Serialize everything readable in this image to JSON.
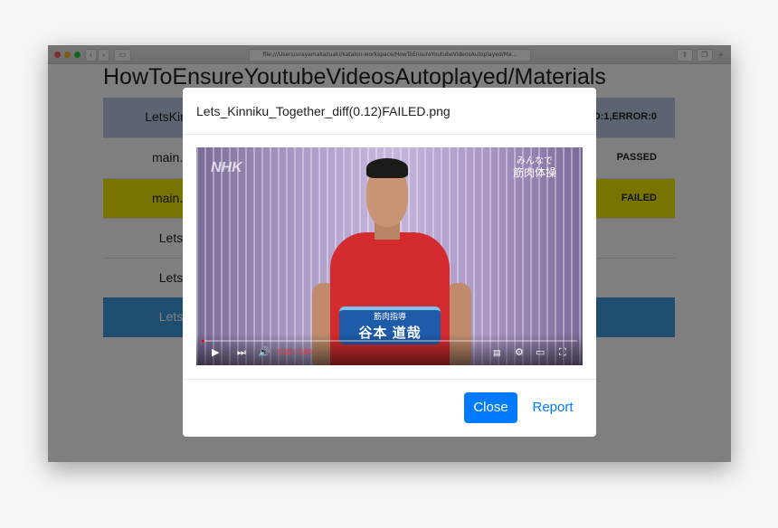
{
  "browser": {
    "url": "file:///Users/urayamakazuaki/katalon-workspace/HowToEnsureYoutubeVideosAutoplayed/Ma..."
  },
  "page": {
    "title": "HowToEnsureYoutubeVideosAutoplayed/Materials",
    "rows": [
      {
        "name": "LetsKinni",
        "status": "D:1,ERROR:0",
        "color": "#b9c8e3"
      },
      {
        "name": "main.L",
        "status": "PASSED",
        "color": "#ffffff"
      },
      {
        "name": "main.L",
        "status": "FAILED",
        "color": "#f2e600"
      },
      {
        "name": "Lets",
        "status": "",
        "color": "#ffffff"
      },
      {
        "name": "Lets",
        "status": "",
        "color": "#ffffff"
      },
      {
        "name": "Lets",
        "status": "",
        "color": "#3d9be0"
      }
    ]
  },
  "modal": {
    "title": "Lets_Kinniku_Together_diff(0.12)FAILED.png",
    "close_label": "Close",
    "report_label": "Report"
  },
  "video": {
    "corner_line1": "みんなで",
    "corner_line2": "筋肉体操",
    "caption_top": "筋肉指導",
    "caption_name": "谷本 道哉",
    "time": "0:02 / 4:50",
    "progress": 0.007,
    "logo": "NHK"
  },
  "colors": {
    "primary": "#007bff",
    "failed": "#f2e600",
    "selected": "#3d9be0",
    "header": "#b9c8e3"
  }
}
